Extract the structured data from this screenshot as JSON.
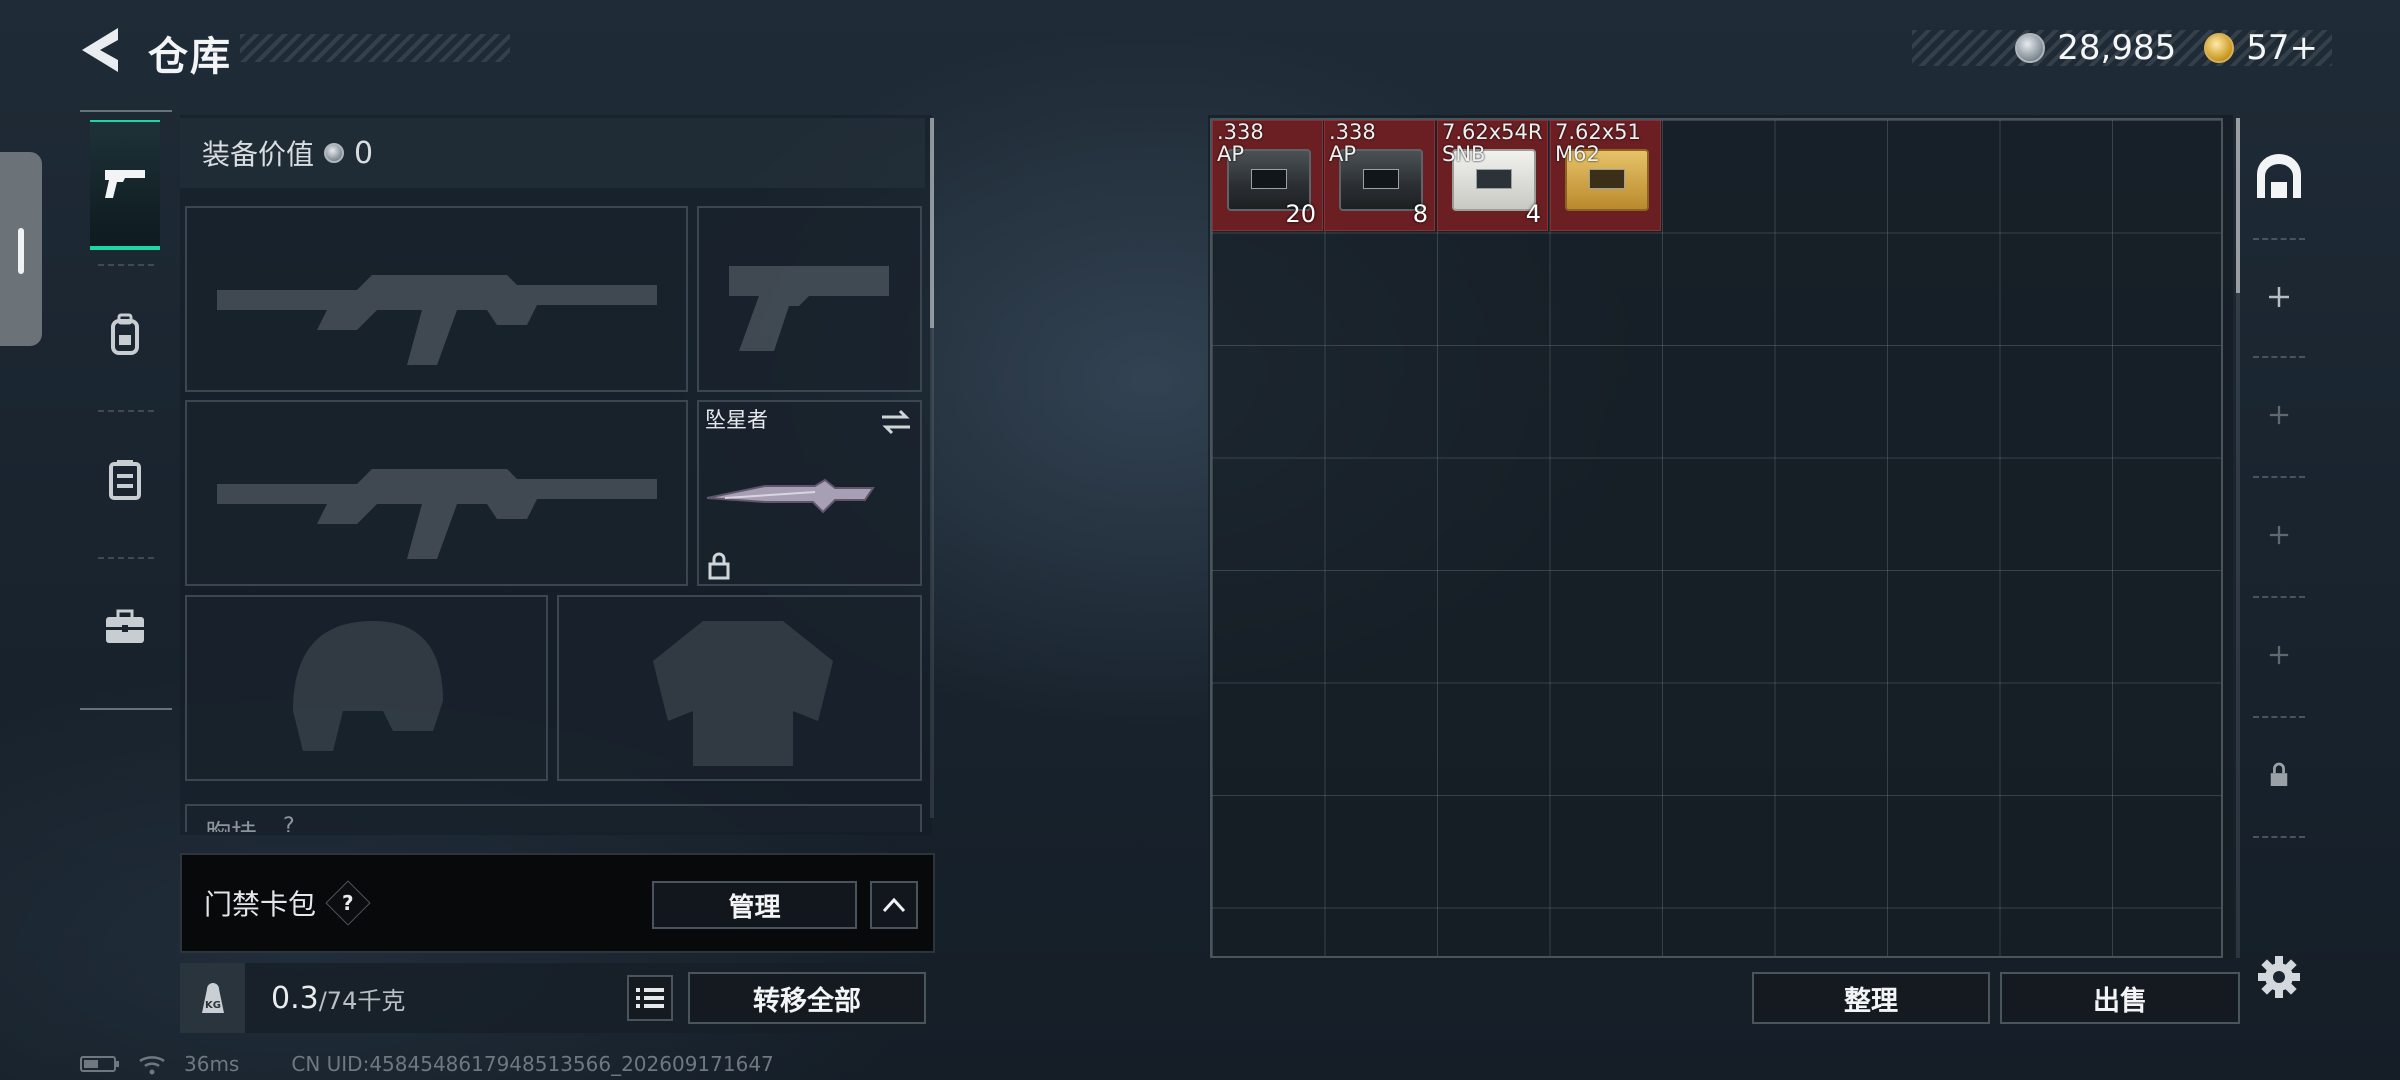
{
  "header": {
    "title": "仓库",
    "currency": [
      {
        "icon": "silver-coin-icon",
        "value": "28,985"
      },
      {
        "icon": "gold-coin-icon",
        "value": "57+"
      }
    ]
  },
  "left_rail": {
    "tabs": [
      {
        "icon": "pistol-icon",
        "active": true
      },
      {
        "icon": "backpack-icon",
        "active": false
      },
      {
        "icon": "vest-icon",
        "active": false
      },
      {
        "icon": "briefcase-icon",
        "active": false
      }
    ]
  },
  "loadout": {
    "value_label": "装备价值",
    "value": "0",
    "melee_slot_title": "坠星者",
    "chest_rig_label": "胸挂",
    "chest_rig_hint": "?"
  },
  "card_bag": {
    "label": "门禁卡包",
    "hint": "?",
    "manage_label": "管理"
  },
  "weight": {
    "kg_label": "KG",
    "current": "0.3",
    "max": "/74千克",
    "transfer_all_label": "转移全部"
  },
  "stash": {
    "items": [
      {
        "name": ".338\nAP",
        "qty": "20",
        "style": "dark"
      },
      {
        "name": ".338\nAP",
        "qty": "8",
        "style": "dark"
      },
      {
        "name": "7.62x54R\nSNB",
        "qty": "4",
        "style": "white"
      },
      {
        "name": "7.62x51\nM62",
        "qty": "",
        "style": "gold"
      }
    ],
    "sort_label": "整理",
    "sell_label": "出售"
  },
  "status_bar": {
    "ping": "36ms",
    "uid": "CN UID:4584548617948513566_202609171647"
  },
  "colors": {
    "accent": "#1ed5a6",
    "item_bg": "#6b1f22"
  }
}
